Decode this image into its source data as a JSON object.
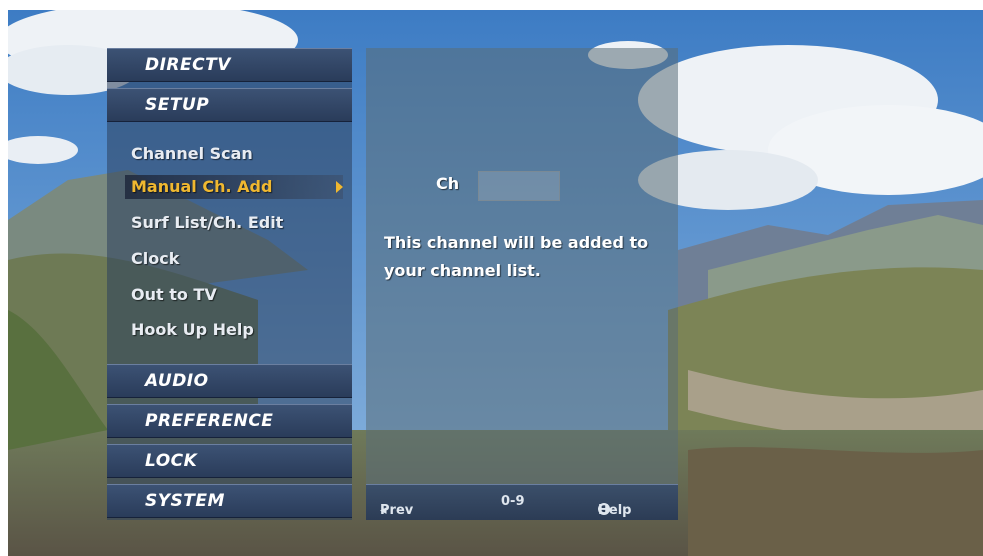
{
  "menu": {
    "brand": "DIRECTV",
    "section": "SETUP",
    "items": [
      {
        "label": "Channel Scan"
      },
      {
        "label": "Manual Ch. Add"
      },
      {
        "label": "Surf List/Ch. Edit"
      },
      {
        "label": "Clock"
      },
      {
        "label": "Out to TV"
      },
      {
        "label": "Hook Up Help"
      }
    ],
    "selected_index": 1,
    "sections": [
      {
        "label": "AUDIO"
      },
      {
        "label": "PREFERENCE"
      },
      {
        "label": "LOCK"
      },
      {
        "label": "SYSTEM"
      }
    ]
  },
  "panel": {
    "ch_label": "Ch",
    "ch_value": "",
    "message": "This channel will be added to your channel list."
  },
  "footer": {
    "prev": "Prev",
    "digits": "0-9",
    "help": "Help"
  },
  "colors": {
    "highlight_text": "#f0b830",
    "header_bg": "#2f4263",
    "normal_text": "#e8ecf2"
  },
  "icons": {
    "prev": "left-triangle-icon",
    "help": "circle-button-icon",
    "submenu": "right-arrow-icon"
  }
}
